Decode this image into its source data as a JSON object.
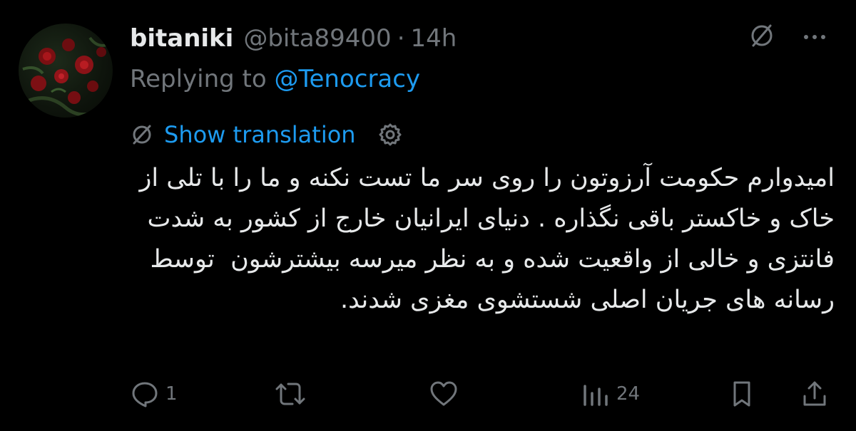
{
  "post": {
    "display_name": "bitaniki",
    "handle": "@bita89400",
    "separator": "·",
    "time": "14h",
    "replying_prefix": "Replying to ",
    "replying_to": "@Tenocracy",
    "show_translation": "Show translation",
    "text": "امیدوارم حکومت آرزوتون را روی سر ما تست نکنه و ما را با تلی از خاک و خاکستر باقی نگذاره . دنیای ایرانیان خارج از کشور به شدت فانتزی و خالی از واقعیت شده و به نظر میرسه بیشترشون  توسط رسانه های جریان اصلی شستشوی مغزی شدند."
  },
  "actions": {
    "reply_count": "1",
    "repost_count": "",
    "like_count": "",
    "views_count": "24"
  },
  "icons": {
    "grok": "slashed-circle-icon",
    "more": "more-dots-icon",
    "translate": "slashed-circle-icon",
    "settings": "gear-icon",
    "reply": "speech-bubble-icon",
    "repost": "repost-arrows-icon",
    "like": "heart-icon",
    "views": "bar-chart-icon",
    "bookmark": "bookmark-icon",
    "share": "share-upload-icon"
  },
  "colors": {
    "background": "#000000",
    "primary_text": "#e7e9ea",
    "secondary_text": "#71767b",
    "link": "#1d9bf0"
  }
}
